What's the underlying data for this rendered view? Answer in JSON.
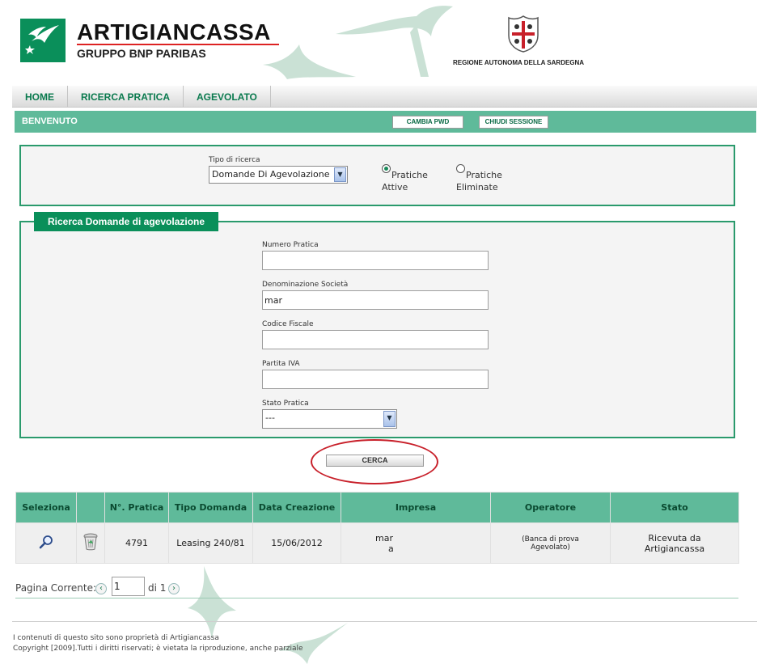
{
  "header": {
    "brand": "ARTIGIANCASSA",
    "brand_sub": "GRUPPO BNP PARIBAS",
    "region": "REGIONE AUTONOMA DELLA SARDEGNA"
  },
  "nav": {
    "items": [
      "HOME",
      "RICERCA PRATICA",
      "AGEVOLATO"
    ]
  },
  "welcome": {
    "text": "BENVENUTO",
    "change_pwd": "CAMBIA PWD",
    "close_session": "CHIUDI SESSIONE"
  },
  "search_type": {
    "label": "Tipo di ricerca",
    "selected": "Domande Di Agevolazione",
    "radio_active_line1": "Pratiche",
    "radio_active_line2": "Attive",
    "radio_deleted_line1": "Pratiche",
    "radio_deleted_line2": "Eliminate"
  },
  "form": {
    "legend": "Ricerca Domande di agevolazione",
    "numero_pratica": {
      "label": "Numero Pratica",
      "value": ""
    },
    "denominazione": {
      "label": "Denominazione Società",
      "value": "mar"
    },
    "codice_fiscale": {
      "label": "Codice Fiscale",
      "value": ""
    },
    "partita_iva": {
      "label": "Partita IVA",
      "value": ""
    },
    "stato_pratica": {
      "label": "Stato Pratica",
      "selected": "---"
    },
    "search_button": "CERCA"
  },
  "table": {
    "headers": [
      "Seleziona",
      "",
      "N°. Pratica",
      "Tipo Domanda",
      "Data Creazione",
      "Impresa",
      "Operatore",
      "Stato"
    ],
    "rows": [
      {
        "numero": "4791",
        "tipo": "Leasing 240/81",
        "data": "15/06/2012",
        "impresa_line1": "mar",
        "impresa_line2": "a",
        "operatore_line1": "(Banca di prova",
        "operatore_line2": "Agevolato)",
        "stato_line1": "Ricevuta da",
        "stato_line2": "Artigiancassa"
      }
    ]
  },
  "pager": {
    "label": "Pagina Corrente:",
    "current": "1",
    "of_label": "di 1"
  },
  "footer": {
    "line1": "I contenuti di questo sito sono proprietà di Artigiancassa",
    "line2": "Copyright [2009].Tutti i diritti riservati; è vietata la riproduzione, anche parziale"
  },
  "colors": {
    "accent": "#0a8f5a",
    "bar": "#5fba9a",
    "highlight": "#c8202a"
  }
}
